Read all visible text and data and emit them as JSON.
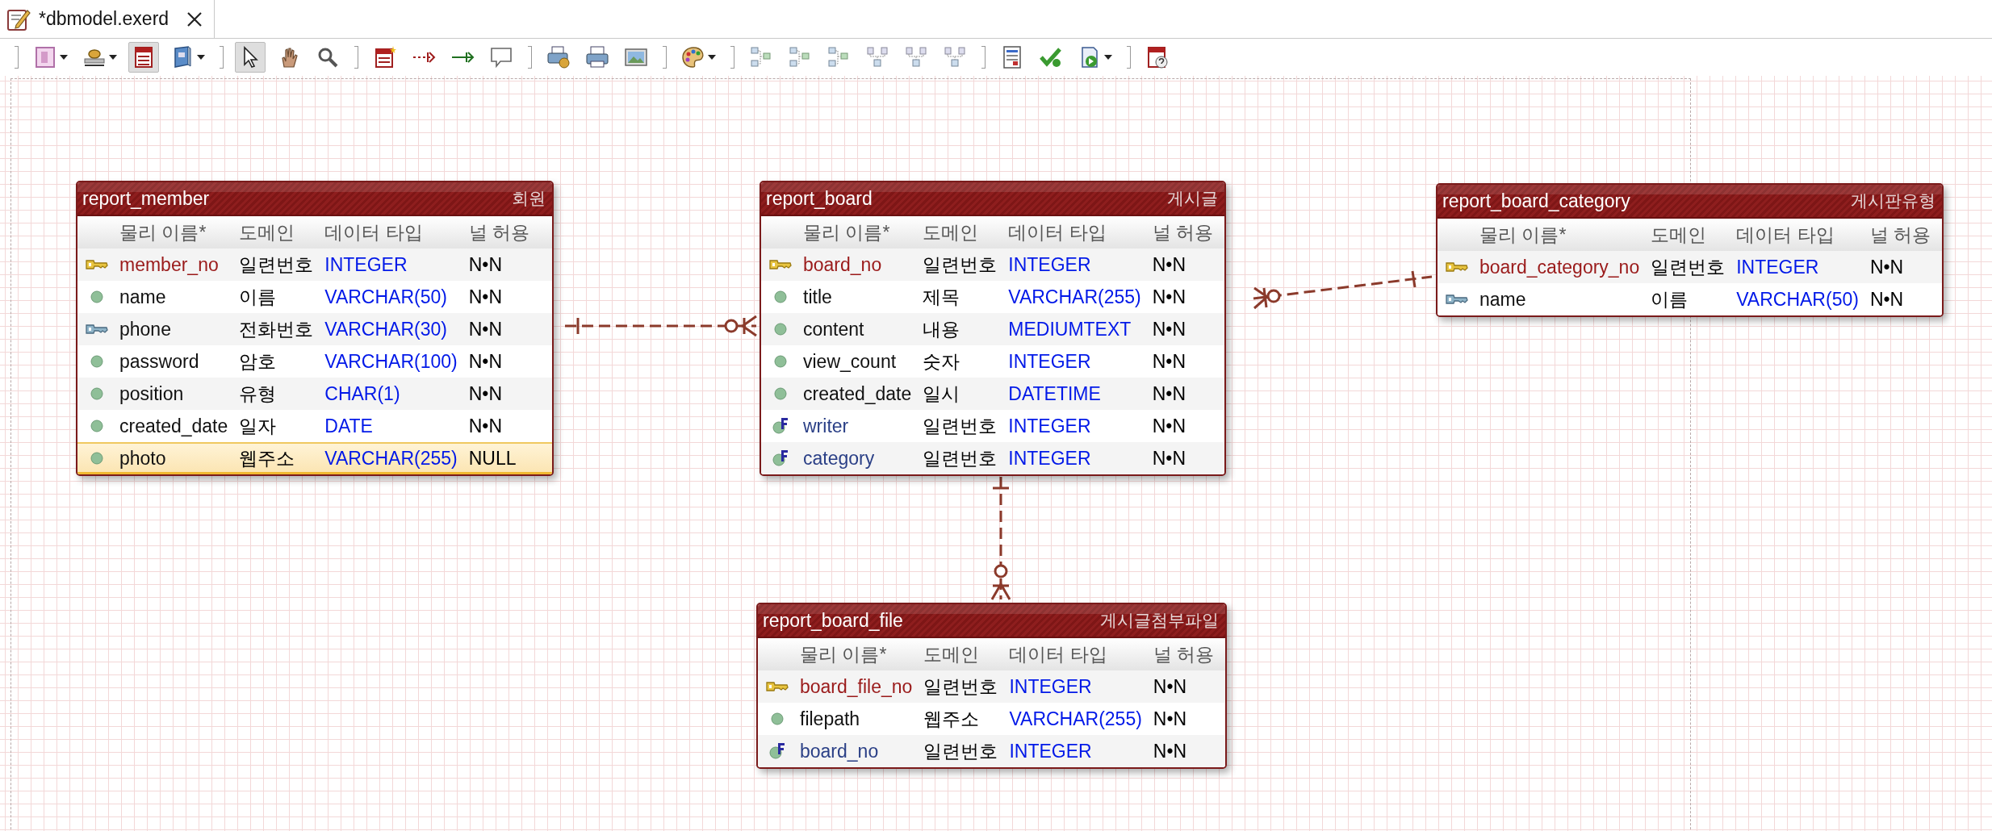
{
  "tab": {
    "title": "*dbmodel.exerd",
    "selected": true
  },
  "toolbar": [
    {
      "kind": "separator"
    },
    {
      "kind": "button",
      "selected": false,
      "dropdown": true
    },
    {
      "kind": "button",
      "selected": false,
      "dropdown": true
    },
    {
      "kind": "button",
      "selected": true,
      "dropdown": false
    },
    {
      "kind": "button",
      "selected": false,
      "dropdown": true
    },
    {
      "kind": "separator"
    },
    {
      "kind": "button",
      "selected": true,
      "dropdown": false
    },
    {
      "kind": "button",
      "selected": false,
      "dropdown": false
    },
    {
      "kind": "button",
      "selected": false,
      "dropdown": false
    },
    {
      "kind": "separator"
    },
    {
      "kind": "button",
      "selected": false,
      "dropdown": false
    },
    {
      "kind": "button",
      "selected": false,
      "dropdown": false
    },
    {
      "kind": "button",
      "selected": false,
      "dropdown": false
    },
    {
      "kind": "button",
      "selected": false,
      "dropdown": false
    },
    {
      "kind": "separator"
    },
    {
      "kind": "button",
      "selected": false,
      "dropdown": false
    },
    {
      "kind": "button",
      "selected": false,
      "dropdown": false
    },
    {
      "kind": "button",
      "selected": false,
      "dropdown": false
    },
    {
      "kind": "separator"
    },
    {
      "kind": "button",
      "selected": false,
      "dropdown": true
    },
    {
      "kind": "separator"
    },
    {
      "kind": "button",
      "selected": false,
      "dropdown": false
    },
    {
      "kind": "button",
      "selected": false,
      "dropdown": false
    },
    {
      "kind": "button",
      "selected": false,
      "dropdown": false
    },
    {
      "kind": "button",
      "selected": false,
      "dropdown": false
    },
    {
      "kind": "button",
      "selected": false,
      "dropdown": false
    },
    {
      "kind": "button",
      "selected": false,
      "dropdown": false
    },
    {
      "kind": "separator"
    },
    {
      "kind": "button",
      "selected": false,
      "dropdown": false
    },
    {
      "kind": "button",
      "selected": false,
      "dropdown": false
    },
    {
      "kind": "button",
      "selected": false,
      "dropdown": true
    },
    {
      "kind": "separator"
    },
    {
      "kind": "button",
      "selected": false,
      "dropdown": false
    }
  ],
  "tables": [
    {
      "name": "report_member",
      "logical_name": "회원",
      "headers": [
        "물리 이름*",
        "도메인",
        "데이터 타입",
        "널 허용"
      ],
      "rows": [
        {
          "kind": "primary_key",
          "name": "member_no",
          "domain": "일련번호",
          "type": "INTEGER",
          "nullable": "N•N",
          "selected": false
        },
        {
          "kind": "column",
          "name": "name",
          "domain": "이름",
          "type": "VARCHAR(50)",
          "nullable": "N•N",
          "selected": false
        },
        {
          "kind": "alternate_key",
          "name": "phone",
          "domain": "전화번호",
          "type": "VARCHAR(30)",
          "nullable": "N•N",
          "selected": false
        },
        {
          "kind": "column",
          "name": "password",
          "domain": "암호",
          "type": "VARCHAR(100)",
          "nullable": "N•N",
          "selected": false
        },
        {
          "kind": "column",
          "name": "position",
          "domain": "유형",
          "type": "CHAR(1)",
          "nullable": "N•N",
          "selected": false
        },
        {
          "kind": "column",
          "name": "created_date",
          "domain": "일자",
          "type": "DATE",
          "nullable": "N•N",
          "selected": false
        },
        {
          "kind": "column",
          "name": "photo",
          "domain": "웹주소",
          "type": "VARCHAR(255)",
          "nullable": "NULL",
          "selected": true
        }
      ]
    },
    {
      "name": "report_board",
      "logical_name": "게시글",
      "headers": [
        "물리 이름*",
        "도메인",
        "데이터 타입",
        "널 허용"
      ],
      "rows": [
        {
          "kind": "primary_key",
          "name": "board_no",
          "domain": "일련번호",
          "type": "INTEGER",
          "nullable": "N•N",
          "selected": false
        },
        {
          "kind": "column",
          "name": "title",
          "domain": "제목",
          "type": "VARCHAR(255)",
          "nullable": "N•N",
          "selected": false
        },
        {
          "kind": "column",
          "name": "content",
          "domain": "내용",
          "type": "MEDIUMTEXT",
          "nullable": "N•N",
          "selected": false
        },
        {
          "kind": "column",
          "name": "view_count",
          "domain": "숫자",
          "type": "INTEGER",
          "nullable": "N•N",
          "selected": false
        },
        {
          "kind": "column",
          "name": "created_date",
          "domain": "일시",
          "type": "DATETIME",
          "nullable": "N•N",
          "selected": false
        },
        {
          "kind": "foreign_key",
          "name": "writer",
          "domain": "일련번호",
          "type": "INTEGER",
          "nullable": "N•N",
          "selected": false
        },
        {
          "kind": "foreign_key",
          "name": "category",
          "domain": "일련번호",
          "type": "INTEGER",
          "nullable": "N•N",
          "selected": false
        }
      ]
    },
    {
      "name": "report_board_category",
      "logical_name": "게시판유형",
      "headers": [
        "물리 이름*",
        "도메인",
        "데이터 타입",
        "널 허용"
      ],
      "rows": [
        {
          "kind": "primary_key",
          "name": "board_category_no",
          "domain": "일련번호",
          "type": "INTEGER",
          "nullable": "N•N",
          "selected": false
        },
        {
          "kind": "alternate_key",
          "name": "name",
          "domain": "이름",
          "type": "VARCHAR(50)",
          "nullable": "N•N",
          "selected": false
        }
      ]
    },
    {
      "name": "report_board_file",
      "logical_name": "게시글첨부파일",
      "headers": [
        "물리 이름*",
        "도메인",
        "데이터 타입",
        "널 허용"
      ],
      "rows": [
        {
          "kind": "primary_key",
          "name": "board_file_no",
          "domain": "일련번호",
          "type": "INTEGER",
          "nullable": "N•N",
          "selected": false
        },
        {
          "kind": "column",
          "name": "filepath",
          "domain": "웹주소",
          "type": "VARCHAR(255)",
          "nullable": "N•N",
          "selected": false
        },
        {
          "kind": "foreign_key",
          "name": "board_no",
          "domain": "일련번호",
          "type": "INTEGER",
          "nullable": "N•N",
          "selected": false
        }
      ]
    }
  ]
}
